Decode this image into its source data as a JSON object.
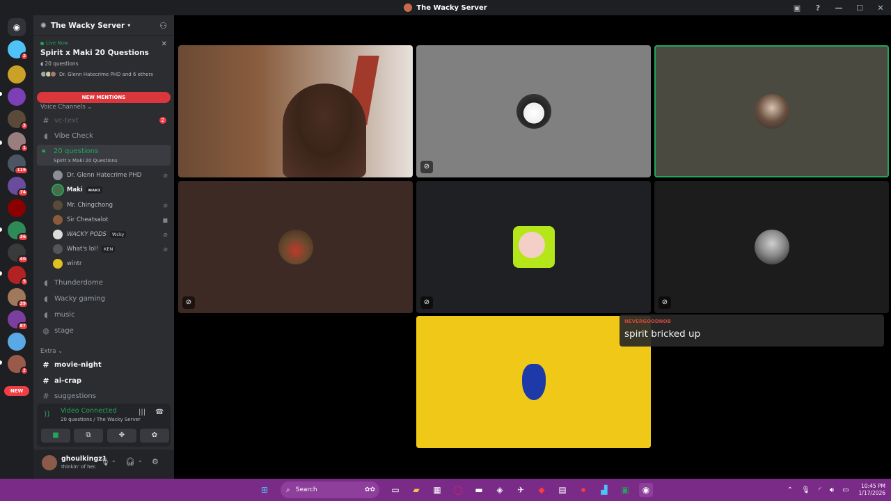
{
  "window": {
    "title": "The Wacky Server"
  },
  "servers": {
    "badges": [
      "2",
      "3",
      "1",
      "119",
      "74",
      "36",
      "40",
      "5",
      "39",
      "87",
      "2"
    ],
    "new_label": "NEW"
  },
  "sidebar": {
    "server_name": "The Wacky Server",
    "live": {
      "now_label": "Live Now",
      "title": "Spirit x Maki 20 Questions",
      "subtitle": "20 questions",
      "participants": "Dr. Glenn Hatecrime PHD and 6 others"
    },
    "new_mentions": "NEW MENTIONS",
    "voice_category": "Voice Channels",
    "channels": {
      "vc_text": "vc-text",
      "vc_text_count": "2",
      "vibe_check": "Vibe Check",
      "twenty_q": "20 questions",
      "twenty_q_status": "Spirit x Maki 20 Questions",
      "thunderdome": "Thunderdome",
      "wacky_gaming": "Wacky gaming",
      "music": "music",
      "stage": "stage"
    },
    "voice_users": [
      {
        "name": "Dr. Glenn Hatecrime PHD",
        "tag": ""
      },
      {
        "name": "Maki",
        "tag": "ᴍᴀᴋɪ"
      },
      {
        "name": "Mr. Chingchong",
        "tag": ""
      },
      {
        "name": "Sir Cheatsalot",
        "tag": ""
      },
      {
        "name": "WACKY PODS",
        "tag": "Wcky"
      },
      {
        "name": "What's lol!",
        "tag": "KEN"
      },
      {
        "name": "wintr",
        "tag": ""
      }
    ],
    "extra_category": "Extra",
    "text_channels": [
      "movie-night",
      "ai-crap",
      "suggestions"
    ],
    "voice_panel": {
      "status": "Video Connected",
      "location": "20 questions / The Wacky Server"
    },
    "user": {
      "name": "ghoulkingz1",
      "status": "thinkin' of her."
    }
  },
  "chat_popup": {
    "author": "NEVERGOODNOB",
    "message": "spirit bricked up"
  },
  "taskbar": {
    "search_label": "Search",
    "time": "10:45 PM",
    "date": "1/17/2026"
  },
  "colors": {
    "accent_green": "#23a55a",
    "mention_red": "#da373c",
    "taskbar": "#7a2b88",
    "yellow_tile": "#f0c818"
  }
}
